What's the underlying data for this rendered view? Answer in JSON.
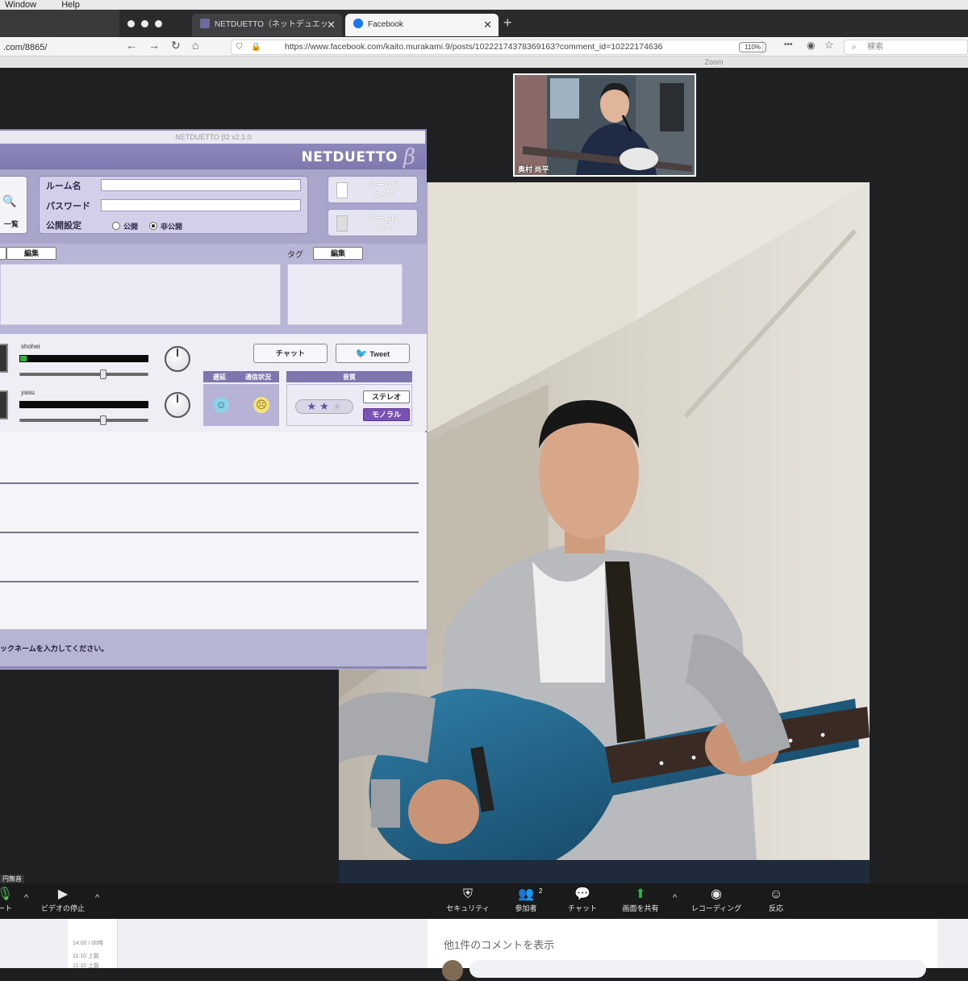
{
  "menubar": {
    "items": [
      "Window",
      "Help"
    ]
  },
  "browser": {
    "left_url": ".com/8865/",
    "tabs": [
      {
        "label": "NETDUETTO（ネットデュエッ",
        "active": false
      },
      {
        "label": "Facebook",
        "active": true
      }
    ],
    "new_tab": "+",
    "close": "✕",
    "url": "https://www.facebook.com/kaito.murakami.9/posts/10222174378369163?comment_id=10222174636",
    "zoom": "110%",
    "search_placeholder": "検索",
    "more": "•••"
  },
  "zoom_app": {
    "window_title": "Zoom",
    "thumbnail_name": "奥村 尚平",
    "toolbar": {
      "mute_badge": "円無音",
      "mute_label": "ート",
      "video_label": "ビデオの停止",
      "security": "セキュリティ",
      "participants": "参加者",
      "participants_count": "2",
      "chat": "チャット",
      "share": "画面を共有",
      "record": "レコーディング",
      "reactions": "反応"
    }
  },
  "netduetto": {
    "title": "NETDUETTO β2 v2.1.0",
    "logo": "NETDUETTO",
    "beta": "β",
    "list_label": "一覧",
    "room_name_label": "ルーム名",
    "password_label": "パスワード",
    "visibility_label": "公開設定",
    "public_label": "公開",
    "private_label": "非公開",
    "create_room": [
      "ルームを",
      "つくる"
    ],
    "enter_room": [
      "ルームに",
      "入る"
    ],
    "edit_label": "編集",
    "tag_label": "タグ",
    "tag_edit_label": "編集",
    "chat_button": "チャット",
    "tweet_button": "Tweet",
    "col_delay": "遅延",
    "col_connection": "通信状況",
    "col_sound": "音質",
    "stereo": "ステレオ",
    "mono": "モノラル",
    "users": [
      {
        "name": "shohei",
        "level": 0.05,
        "slider": 0.66
      },
      {
        "name": "yasu",
        "level": 0.0,
        "slider": 0.66
      }
    ],
    "rating": 2,
    "rating_max": 3,
    "footer": "ックネームを入力してください。"
  },
  "facebook": {
    "comment_link": "他1件のコメントを表示",
    "sidebar_times": [
      "14:00 / 00時",
      "11:10 上能",
      "11:10 上能"
    ]
  },
  "colors": {
    "netduetto_accent": "#7c78ad",
    "zoom_bg": "#1f2022",
    "meter_green": "#2db43a"
  }
}
